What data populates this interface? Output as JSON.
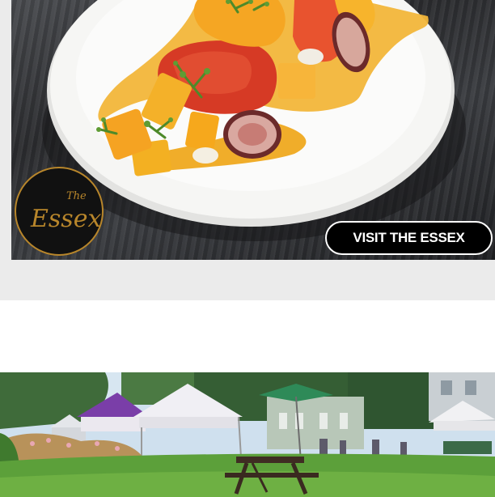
{
  "ad": {
    "brand_logo_text_top": "The",
    "brand_logo_text_main": "Essex",
    "cta_label": "VISIT THE ESSEX",
    "colors": {
      "gold": "#b8862b",
      "plate": "#f4f4f2",
      "board": "#2e2f33",
      "band": "#ebebeb"
    }
  },
  "photo": {
    "scene": "outdoor-market-tents-on-lawn"
  }
}
